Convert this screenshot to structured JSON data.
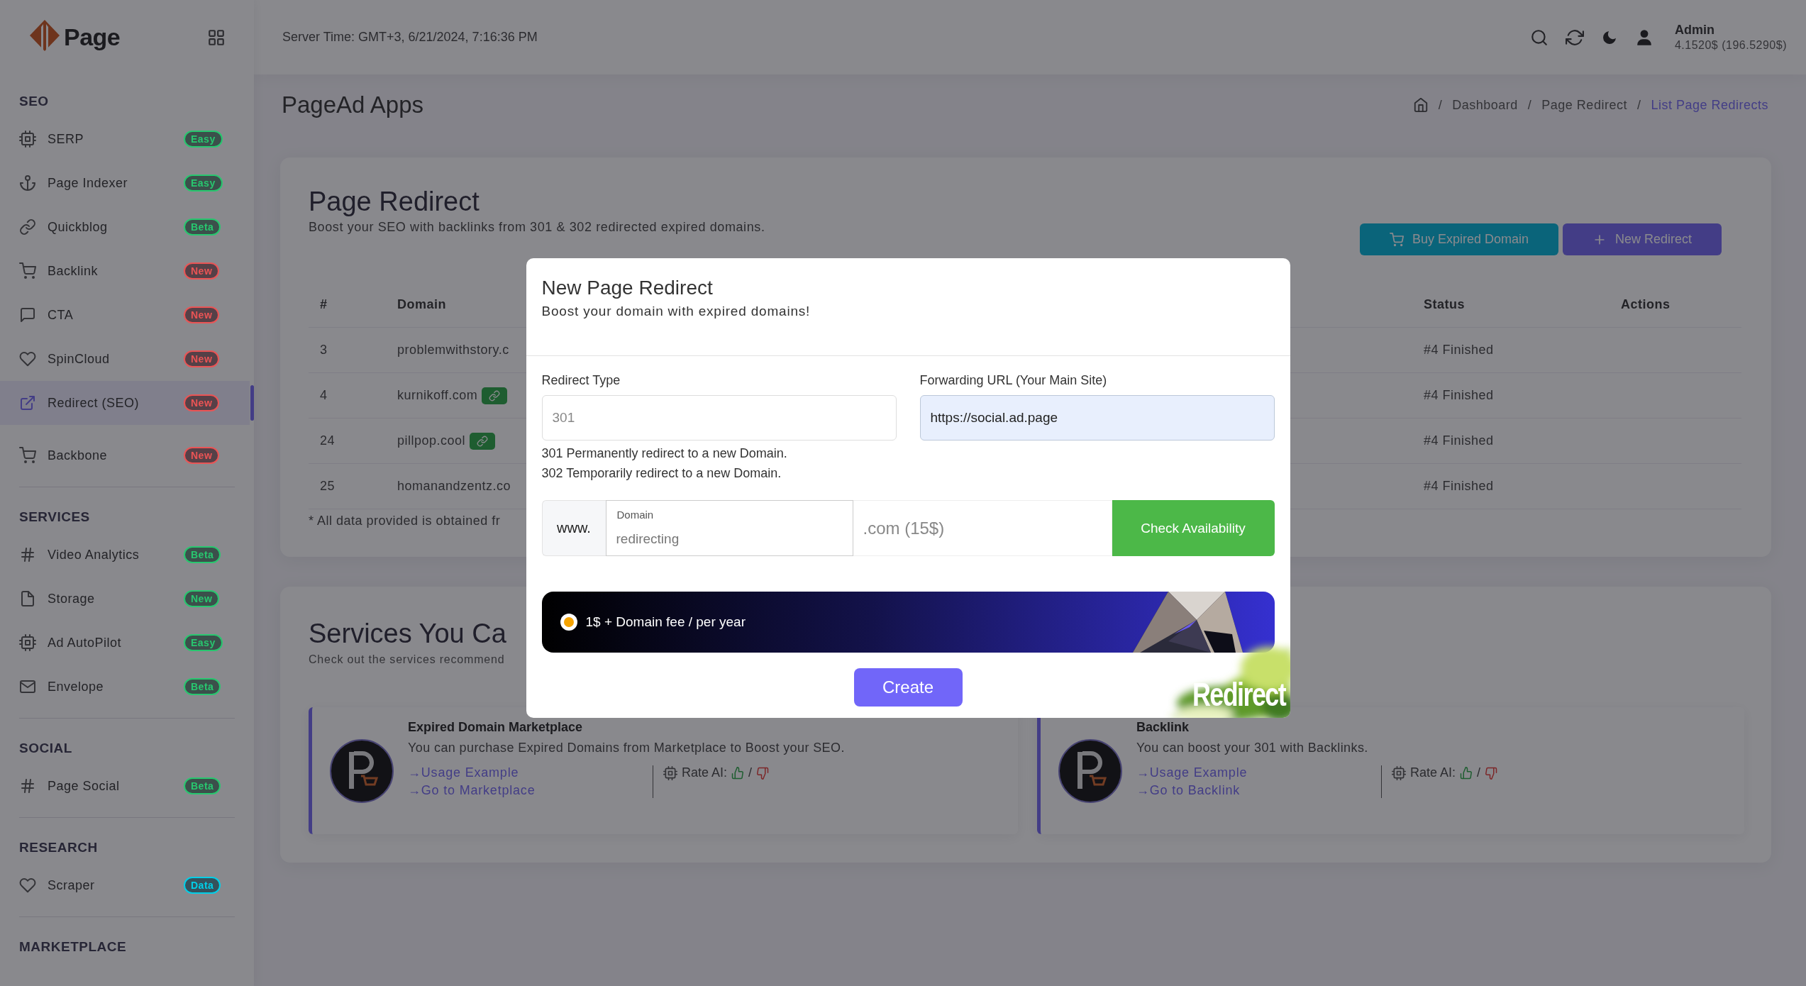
{
  "sidebar": {
    "logo": {
      "text": "Page"
    },
    "sections": [
      {
        "title": "SEO",
        "items": [
          {
            "label": "SERP",
            "badge": "Easy",
            "color": "#28c76f",
            "selected": false
          },
          {
            "label": "Page Indexer",
            "badge": "Easy",
            "color": "#28c76f",
            "selected": false
          },
          {
            "label": "Quickblog",
            "badge": "Beta",
            "color": "#28c76f",
            "selected": false
          },
          {
            "label": "Backlink",
            "badge": "New",
            "color": "#ea5455",
            "selected": false
          },
          {
            "label": "CTA",
            "badge": "New",
            "color": "#ea5455",
            "selected": false
          },
          {
            "label": "SpinCloud",
            "badge": "New",
            "color": "#ea5455",
            "selected": false
          },
          {
            "label": "Redirect (SEO)",
            "badge": "New",
            "color": "#ea5455",
            "selected": true
          },
          {
            "label": "Backbone",
            "badge": "New",
            "color": "#ea5455",
            "selected": false
          }
        ]
      },
      {
        "title": "SERVICES",
        "items": [
          {
            "label": "Video Analytics",
            "badge": "Beta",
            "color": "#28c76f",
            "selected": false
          },
          {
            "label": "Storage",
            "badge": "New",
            "color": "#28c76f",
            "selected": false
          },
          {
            "label": "Ad AutoPilot",
            "badge": "Easy",
            "color": "#28c76f",
            "selected": false
          },
          {
            "label": "Envelope",
            "badge": "Beta",
            "color": "#28c76f",
            "selected": false
          }
        ]
      },
      {
        "title": "SOCIAL",
        "items": [
          {
            "label": "Page Social",
            "badge": "Beta",
            "color": "#28c76f",
            "selected": false
          }
        ]
      },
      {
        "title": "RESEARCH",
        "items": [
          {
            "label": "Scraper",
            "badge": "Data",
            "color": "#00cfe8",
            "selected": false
          }
        ]
      },
      {
        "title": "MARKETPLACE"
      }
    ]
  },
  "header": {
    "server_time": "Server Time: GMT+3, 6/21/2024, 7:16:36 PM",
    "user": {
      "name": "Admin",
      "balance": "4.1520$ (196.5290$)"
    }
  },
  "page": {
    "title": "PageAd Apps",
    "separator": "/",
    "breadcrumb": [
      {
        "label": "Dashboard",
        "selected": false
      },
      {
        "label": "Page Redirect",
        "selected": false
      },
      {
        "label": "List Page Redirects",
        "selected": true
      }
    ]
  },
  "redirect_card": {
    "title": "Page Redirect",
    "subtitle": "Boost your SEO with backlinks from 301 & 302 redirected expired domains.",
    "buttons": [
      {
        "label": "Buy Expired Domain",
        "kind": "cart"
      },
      {
        "label": "New Redirect",
        "kind": "plus"
      }
    ],
    "table": {
      "columns": [
        "#",
        "Domain",
        "Status",
        "Actions"
      ],
      "rows": [
        {
          "number": "3",
          "domain": "problemwithstory.c",
          "linked": false,
          "status": "#4 Finished"
        },
        {
          "number": "4",
          "domain": "kurnikoff.com",
          "linked": true,
          "status": "#4 Finished"
        },
        {
          "number": "24",
          "domain": "pillpop.cool",
          "linked": true,
          "status": "#4 Finished"
        },
        {
          "number": "25",
          "domain": "homanandzentz.co",
          "linked": false,
          "status": "#4 Finished"
        }
      ]
    },
    "note": "* All data provided is obtained fr"
  },
  "services_card": {
    "title": "Services You Ca",
    "subtitle": "Check out the services recommend",
    "items": [
      {
        "title": "Expired Domain Marketplace",
        "description": "You can purchase Expired Domains from Marketplace to Boost your SEO.",
        "links": [
          "→Usage Example",
          "→Go to Marketplace"
        ],
        "rating_label": "Rate AI:",
        "separator": "/"
      },
      {
        "title": "Backlink",
        "description": "You can boost your 301 with Backlinks.",
        "links": [
          "→Usage Example",
          "→Go to Backlink"
        ],
        "rating_label": "Rate AI:",
        "separator": "/"
      }
    ]
  },
  "modal": {
    "title": "New Page Redirect",
    "subtitle": "Boost your domain with expired domains!",
    "redirect_type": {
      "label": "Redirect Type",
      "placeholder": "301"
    },
    "hints": [
      "301 Permanently redirect to a new Domain.",
      "302 Temporarily redirect to a new Domain."
    ],
    "forwarding_url": {
      "label": "Forwarding URL (Your Main Site)",
      "value": "https://social.ad.page"
    },
    "domain": {
      "prefix": "www.",
      "label": "Domain",
      "placeholder": "redirecting",
      "suffix": ".com (15$)"
    },
    "check_button": "Check Availability",
    "plan": {
      "label": "1$ + Domain fee / per year",
      "selected": true
    },
    "create_button": "Create",
    "sticker": "Redirect"
  }
}
